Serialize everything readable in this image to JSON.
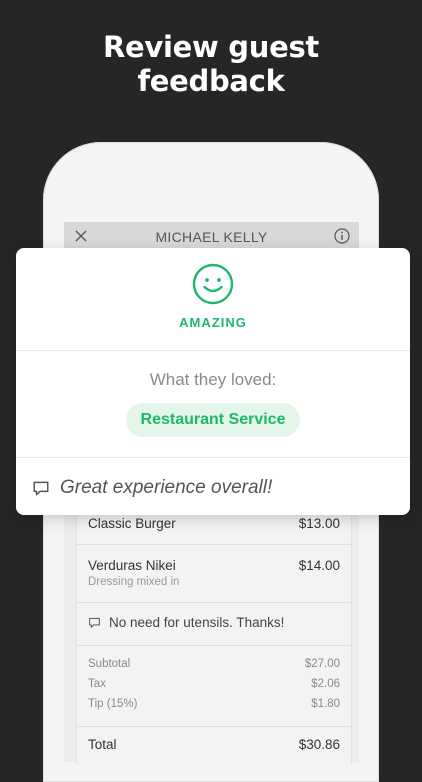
{
  "headline": {
    "line1": "Review guest",
    "line2": "feedback"
  },
  "modal": {
    "title": "MICHAEL KELLY",
    "close_icon": "close-icon",
    "info_icon": "info-icon"
  },
  "feedback": {
    "rating_icon": "smiley-face-icon",
    "rating": "AMAZING",
    "loved_label": "What they loved:",
    "loved_tag": "Restaurant Service",
    "comment_icon": "speech-bubble-icon",
    "comment": "Great experience overall!"
  },
  "receipt": {
    "items": [
      {
        "name": "Classic Burger",
        "price": "$13.00",
        "note": ""
      },
      {
        "name": "Verduras Nikei",
        "price": "$14.00",
        "note": "Dressing mixed in"
      }
    ],
    "order_note": "No need for utensils. Thanks!",
    "subtotal_label": "Subtotal",
    "subtotal": "$27.00",
    "tax_label": "Tax",
    "tax": "$2.06",
    "tip_label": "Tip (15%)",
    "tip": "$1.80",
    "total_label": "Total",
    "total": "$30.86"
  },
  "colors": {
    "accent": "#1fb86a",
    "accent_light": "#e4f5ea",
    "background": "#262626"
  }
}
